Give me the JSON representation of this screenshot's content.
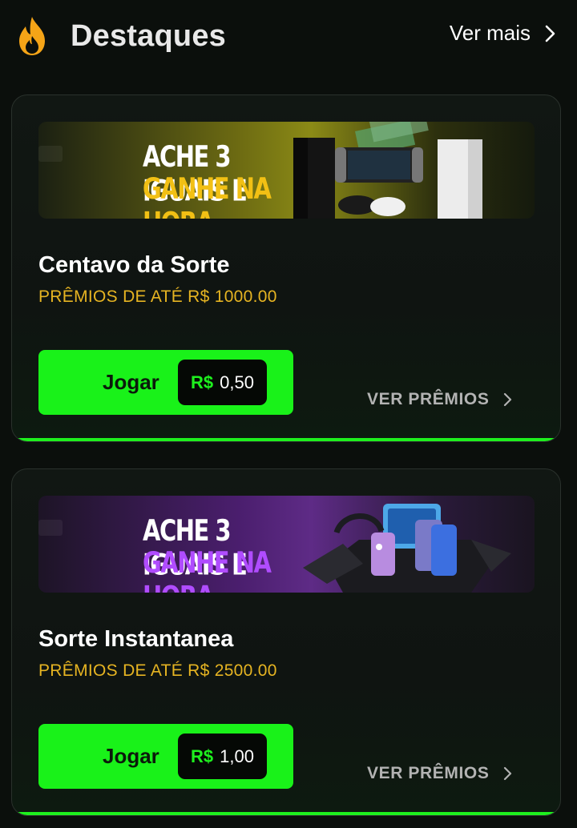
{
  "header": {
    "title": "Destaques",
    "see_more": "Ver mais",
    "icon": "fire-icon",
    "accent": "#f5a417"
  },
  "cards": [
    {
      "banner": {
        "line1": "ACHE 3 IGUAIS E",
        "line2": "GANHE NA HORA",
        "theme": "yellow",
        "image": "consoles-and-cash"
      },
      "title": "Centavo da Sorte",
      "subtitle": "PRÊMIOS DE ATÉ R$ 1000.00",
      "play_label": "Jogar",
      "price_currency": "R$",
      "price_value": "0,50",
      "prizes_label": "VER PRÊMIOS"
    },
    {
      "banner": {
        "line1": "ACHE 3 IGUAIS E",
        "line2": "GANHE NA HORA",
        "theme": "purple",
        "image": "phones-and-tablets"
      },
      "title": "Sorte Instantanea",
      "subtitle": "PRÊMIOS DE ATÉ R$ 2500.00",
      "play_label": "Jogar",
      "price_currency": "R$",
      "price_value": "1,00",
      "prizes_label": "VER PRÊMIOS"
    }
  ],
  "colors": {
    "primary_green": "#19f219",
    "subtitle_gold": "#e6b422",
    "background": "#0b0f0c"
  }
}
